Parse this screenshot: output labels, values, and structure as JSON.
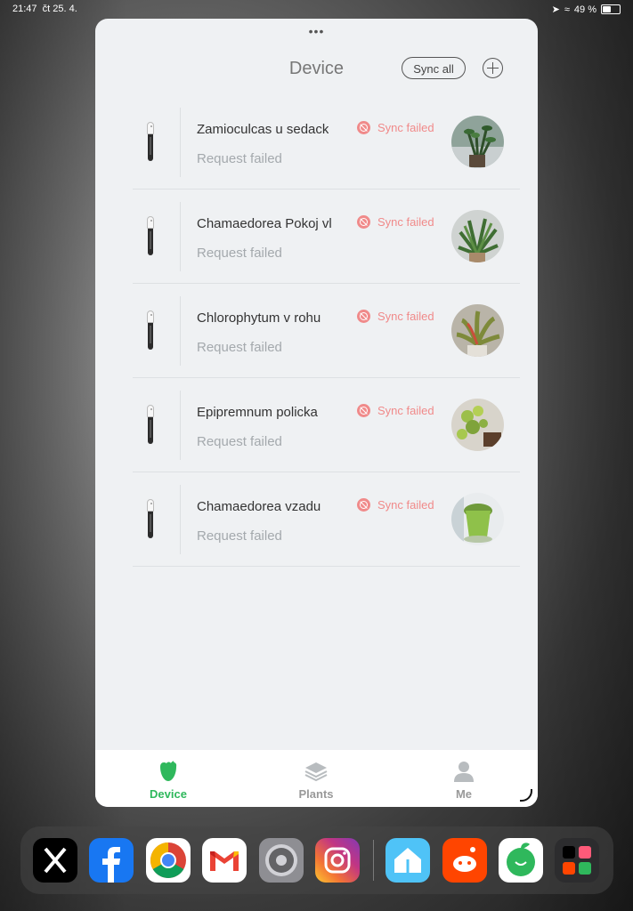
{
  "statusbar": {
    "time": "21:47",
    "date": "čt 25. 4.",
    "battery": "49 %"
  },
  "header": {
    "title": "Device",
    "sync_label": "Sync all"
  },
  "devices": [
    {
      "name": "Zamioculcas u sedack",
      "status": "Sync failed",
      "sub": "Request failed"
    },
    {
      "name": "Chamaedorea Pokoj vl",
      "status": "Sync failed",
      "sub": "Request failed"
    },
    {
      "name": "Chlorophytum v rohu",
      "status": "Sync failed",
      "sub": "Request failed"
    },
    {
      "name": "Epipremnum policka",
      "status": "Sync failed",
      "sub": "Request failed"
    },
    {
      "name": "Chamaedorea vzadu",
      "status": "Sync failed",
      "sub": "Request failed"
    }
  ],
  "tabs": [
    {
      "label": "Device",
      "icon": "leaf-icon",
      "active": true
    },
    {
      "label": "Plants",
      "icon": "stack-icon",
      "active": false
    },
    {
      "label": "Me",
      "icon": "person-icon",
      "active": false
    }
  ],
  "dock": [
    "x-app-icon",
    "facebook-app-icon",
    "chrome-app-icon",
    "gmail-app-icon",
    "settings-app-icon",
    "instagram-app-icon",
    "home-app-icon",
    "reddit-app-icon",
    "plant-app-icon",
    "folder-app-icon"
  ],
  "colors": {
    "accent": "#2fb85c",
    "error": "#f08a8a",
    "background": "#eff1f3"
  }
}
